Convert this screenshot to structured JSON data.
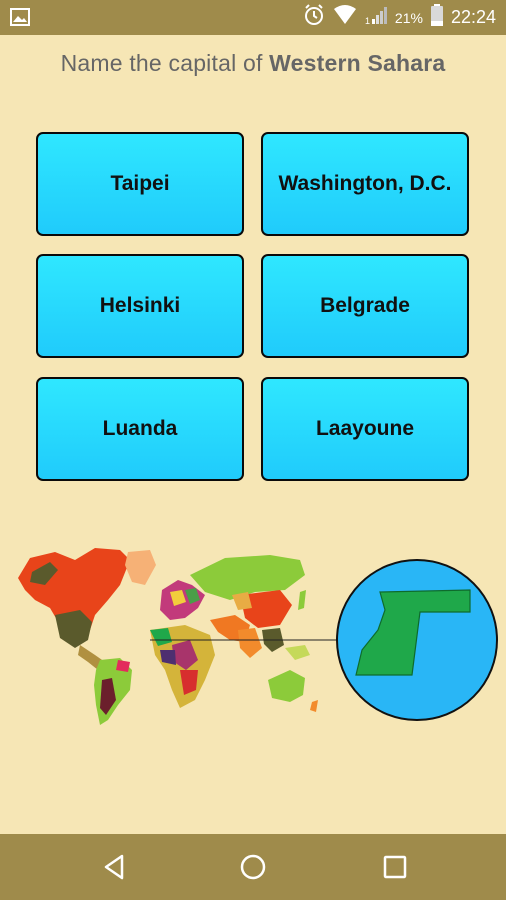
{
  "status_bar": {
    "battery_percent": "21%",
    "time": "22:24",
    "icons": [
      "image-icon",
      "alarm-icon",
      "wifi-icon",
      "cell-signal-icon",
      "battery-icon"
    ]
  },
  "question": {
    "prefix": "Name the capital of ",
    "country": "Western Sahara"
  },
  "answers": [
    "Taipei",
    "Washington, D.C.",
    "Helsinki",
    "Belgrade",
    "Luanda",
    "Laayoune"
  ],
  "map": {
    "ocean_color": "#29B6F6",
    "highlight_color": "#1FA84A",
    "icon": "world-map-icon"
  },
  "nav_bar": {
    "icons": [
      "back-icon",
      "home-icon",
      "recents-icon"
    ]
  },
  "colors": {
    "background": "#F6E6B5",
    "bars": "#9F8B4B",
    "button": "#22D6FD"
  }
}
